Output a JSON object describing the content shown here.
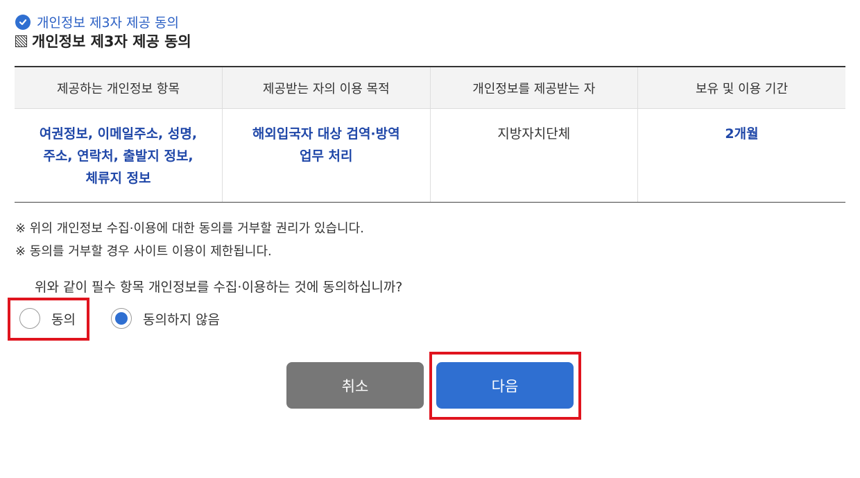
{
  "header": {
    "section_title": "개인정보 제3자 제공 동의",
    "subtitle": "개인정보 제3자 제공 동의"
  },
  "table": {
    "columns": [
      "제공하는 개인정보 항목",
      "제공받는 자의 이용 목적",
      "개인정보를 제공받는 자",
      "보유 및 이용 기간"
    ],
    "row": {
      "items": [
        "여권정보, 이메일주소, 성명,",
        "주소, 연락처, 출발지 정보,",
        "체류지 정보"
      ],
      "purpose": [
        "해외입국자 대상 검역·방역",
        "업무 처리"
      ],
      "recipient": "지방자치단체",
      "period": "2개월"
    }
  },
  "notes": [
    "※ 위의 개인정보 수집·이용에 대한 동의를 거부할 권리가 있습니다.",
    "※ 동의를 거부할 경우 사이트 이용이 제한됩니다."
  ],
  "question": "위와 같이 필수 항목 개인정보를 수집·이용하는 것에 동의하십니까?",
  "options": [
    {
      "label": "동의",
      "selected": false
    },
    {
      "label": "동의하지 않음",
      "selected": true
    }
  ],
  "buttons": {
    "cancel": "취소",
    "next": "다음"
  },
  "colors": {
    "accent_blue": "#2f6fd1",
    "table_blue_text": "#1f47a8",
    "cancel_gray": "#777777",
    "highlight_red": "#e0141e"
  },
  "icons": {
    "header_check": "check-circle-icon",
    "subtitle_bullet": "hatched-square-icon"
  }
}
